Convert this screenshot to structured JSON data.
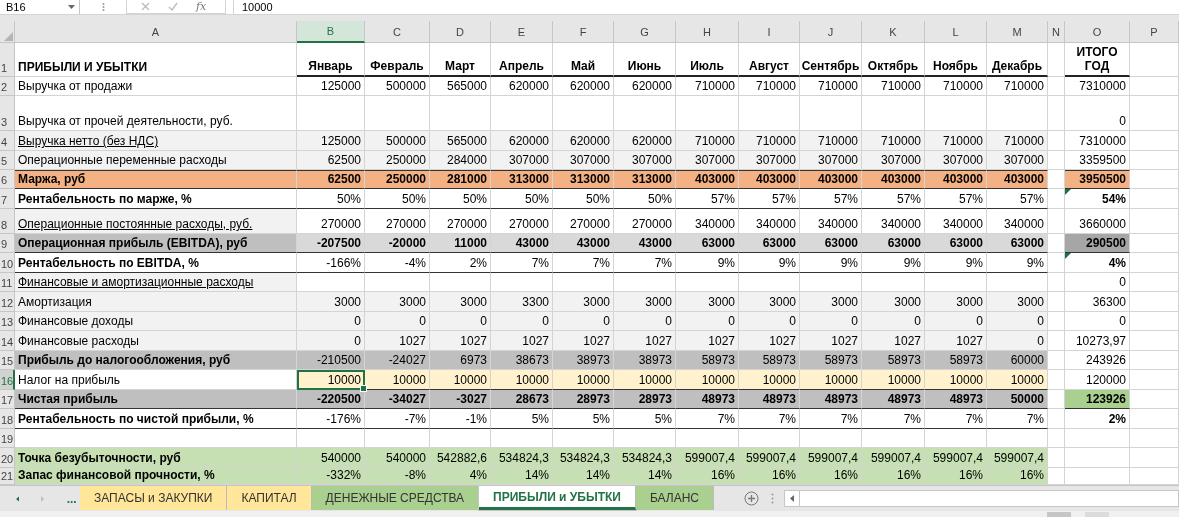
{
  "formula_bar": {
    "name_box": "B16",
    "function_label": "fx",
    "formula": "10000"
  },
  "columns": [
    {
      "label": "A",
      "selected": false
    },
    {
      "label": "B",
      "selected": true
    },
    {
      "label": "C",
      "selected": false
    },
    {
      "label": "D",
      "selected": false
    },
    {
      "label": "E",
      "selected": false
    },
    {
      "label": "F",
      "selected": false
    },
    {
      "label": "G",
      "selected": false
    },
    {
      "label": "H",
      "selected": false
    },
    {
      "label": "I",
      "selected": false
    },
    {
      "label": "J",
      "selected": false
    },
    {
      "label": "K",
      "selected": false
    },
    {
      "label": "L",
      "selected": false
    },
    {
      "label": "M",
      "selected": false
    },
    {
      "label": "N",
      "selected": false
    },
    {
      "label": "O",
      "selected": false
    },
    {
      "label": "P",
      "selected": false
    }
  ],
  "rows": [
    {
      "number": "1",
      "kind": "title",
      "selected": false,
      "total_flagged": false,
      "label": "ПРИБЫЛИ И УБЫТКИ",
      "values": [
        "Январь",
        "Февраль",
        "Март",
        "Апрель",
        "Май",
        "Июнь",
        "Июль",
        "Август",
        "Сентябрь",
        "Октябрь",
        "Ноябрь",
        "Декабрь"
      ],
      "total": "ИТОГО ГОД"
    },
    {
      "number": "2",
      "kind": "plain",
      "selected": false,
      "total_flagged": false,
      "label": "Выручка от продажи",
      "values": [
        "125000",
        "500000",
        "565000",
        "620000",
        "620000",
        "620000",
        "710000",
        "710000",
        "710000",
        "710000",
        "710000",
        "710000"
      ],
      "total": "7310000"
    },
    {
      "number": "3",
      "kind": "plain",
      "selected": false,
      "total_flagged": false,
      "label": "Выручка от прочей деятельности, руб.",
      "total": "0"
    },
    {
      "number": "4",
      "kind": "gray_link",
      "selected": false,
      "total_flagged": false,
      "label": "Выручка нетто (без НДС)",
      "values": [
        "125000",
        "500000",
        "565000",
        "620000",
        "620000",
        "620000",
        "710000",
        "710000",
        "710000",
        "710000",
        "710000",
        "710000"
      ],
      "total": "7310000"
    },
    {
      "number": "5",
      "kind": "gray",
      "selected": false,
      "total_flagged": false,
      "label": "Операционные переменные расходы",
      "values": [
        "62500",
        "250000",
        "284000",
        "307000",
        "307000",
        "307000",
        "307000",
        "307000",
        "307000",
        "307000",
        "307000",
        "307000"
      ],
      "total": "3359500"
    },
    {
      "number": "6",
      "kind": "margin",
      "selected": false,
      "total_flagged": false,
      "label": "Маржа, руб",
      "values": [
        "62500",
        "250000",
        "281000",
        "313000",
        "313000",
        "313000",
        "403000",
        "403000",
        "403000",
        "403000",
        "403000",
        "403000"
      ],
      "total": "3950500"
    },
    {
      "number": "7",
      "kind": "ratio",
      "selected": false,
      "total_flagged": true,
      "label": "Рентабельность по марже, %",
      "values": [
        "50%",
        "50%",
        "50%",
        "50%",
        "50%",
        "50%",
        "57%",
        "57%",
        "57%",
        "57%",
        "57%",
        "57%"
      ],
      "total": "54%"
    },
    {
      "number": "8",
      "kind": "link",
      "selected": false,
      "total_flagged": false,
      "label": "Операционные постоянные расходы, руб.",
      "values": [
        "270000",
        "270000",
        "270000",
        "270000",
        "270000",
        "270000",
        "340000",
        "340000",
        "340000",
        "340000",
        "340000",
        "340000"
      ],
      "total": "3660000"
    },
    {
      "number": "9",
      "kind": "ebitda",
      "selected": false,
      "total_flagged": false,
      "label": "Операционная прибыль (EBITDA), руб",
      "values": [
        "-207500",
        "-20000",
        "11000",
        "43000",
        "43000",
        "43000",
        "63000",
        "63000",
        "63000",
        "63000",
        "63000",
        "63000"
      ],
      "total": "290500"
    },
    {
      "number": "10",
      "kind": "ratio",
      "selected": false,
      "total_flagged": true,
      "label": "Рентабельность по EBITDA, %",
      "values": [
        "-166%",
        "-4%",
        "2%",
        "7%",
        "7%",
        "7%",
        "9%",
        "9%",
        "9%",
        "9%",
        "9%",
        "9%"
      ],
      "total": "4%"
    },
    {
      "number": "11",
      "kind": "link",
      "selected": false,
      "total_flagged": false,
      "label": "Финансовые и амортизационные расходы",
      "total": "0"
    },
    {
      "number": "12",
      "kind": "gray",
      "selected": false,
      "total_flagged": false,
      "label": "Амортизация",
      "values": [
        "3000",
        "3000",
        "3000",
        "3300",
        "3000",
        "3000",
        "3000",
        "3000",
        "3000",
        "3000",
        "3000",
        "3000"
      ],
      "total": "36300"
    },
    {
      "number": "13",
      "kind": "gray",
      "selected": false,
      "total_flagged": false,
      "label": "Финансовые доходы",
      "values": [
        "0",
        "0",
        "0",
        "0",
        "0",
        "0",
        "0",
        "0",
        "0",
        "0",
        "0",
        "0"
      ],
      "total": "0"
    },
    {
      "number": "14",
      "kind": "gray",
      "selected": false,
      "total_flagged": false,
      "label": "Финансовые расходы",
      "values": [
        "0",
        "1027",
        "1027",
        "1027",
        "1027",
        "1027",
        "1027",
        "1027",
        "1027",
        "1027",
        "1027",
        "0"
      ],
      "total": "10273,97"
    },
    {
      "number": "15",
      "kind": "pretax",
      "selected": false,
      "total_flagged": false,
      "label": "Прибыль до налогообложения, руб",
      "values": [
        "-210500",
        "-24027",
        "6973",
        "38673",
        "38973",
        "38973",
        "58973",
        "58973",
        "58973",
        "58973",
        "58973",
        "60000"
      ],
      "total": "243926"
    },
    {
      "number": "16",
      "kind": "input",
      "selected": true,
      "total_flagged": false,
      "label": "Налог на прибыль",
      "values": [
        "10000",
        "10000",
        "10000",
        "10000",
        "10000",
        "10000",
        "10000",
        "10000",
        "10000",
        "10000",
        "10000",
        "10000"
      ],
      "total": "120000"
    },
    {
      "number": "17",
      "kind": "net",
      "selected": false,
      "total_flagged": false,
      "label": "Чистая прибыль",
      "values": [
        "-220500",
        "-34027",
        "-3027",
        "28673",
        "28973",
        "28973",
        "48973",
        "48973",
        "48973",
        "48973",
        "48973",
        "50000"
      ],
      "total": "123926"
    },
    {
      "number": "18",
      "kind": "ratio",
      "selected": false,
      "total_flagged": false,
      "label": "Рентабельность по чистой прибыли, %",
      "values": [
        "-176%",
        "-7%",
        "-1%",
        "5%",
        "5%",
        "5%",
        "7%",
        "7%",
        "7%",
        "7%",
        "7%",
        "7%"
      ],
      "total": "2%"
    },
    {
      "number": "19",
      "kind": "empty",
      "selected": false,
      "total_flagged": false
    },
    {
      "number": "20",
      "kind": "breakeven",
      "selected": false,
      "total_flagged": false,
      "label": "Точка безубыточности, руб",
      "values": [
        "540000",
        "540000",
        "542882,6",
        "534824,3",
        "534824,3",
        "534824,3",
        "599007,4",
        "599007,4",
        "599007,4",
        "599007,4",
        "599007,4",
        "599007,4"
      ]
    },
    {
      "number": "21",
      "kind": "breakeven",
      "selected": false,
      "total_flagged": false,
      "label": "Запас финансовой прочности, %",
      "values": [
        "-332%",
        "-8%",
        "4%",
        "14%",
        "14%",
        "14%",
        "16%",
        "16%",
        "16%",
        "16%",
        "16%",
        "16%"
      ]
    }
  ],
  "sheet_tabs": {
    "more": "...",
    "tabs": [
      {
        "label": "ЗАПАСЫ и ЗАКУПКИ",
        "color": "#ffe699",
        "selected": false
      },
      {
        "label": "КАПИТАЛ",
        "color": "#ffe699",
        "selected": false
      },
      {
        "label": "ДЕНЕЖНЫЕ СРЕДСТВА",
        "color": "#a9d08e",
        "selected": false
      },
      {
        "label": "ПРИБЫЛИ и УБЫТКИ",
        "selected": true
      },
      {
        "label": "БАЛАНС",
        "color": "#a9d08e",
        "selected": false
      }
    ]
  }
}
